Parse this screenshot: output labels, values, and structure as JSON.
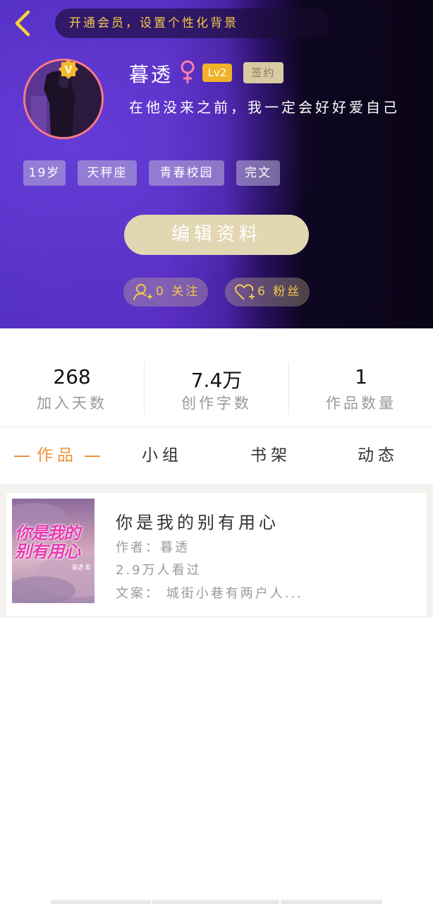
{
  "header": {
    "vip_prompt": "开通会员，设置个性化背景",
    "user_name": "暮透",
    "level": "Lv2",
    "signed": "签约",
    "bio": "在他没来之前，我一定会好好爱自己",
    "tags": [
      "19岁",
      "天秤座",
      "青春校园",
      "完文"
    ],
    "edit_button": "编辑资料",
    "follow": "0 关注",
    "fans": "6 粉丝",
    "colors": {
      "accent_gold": "#f2c84a",
      "header_purple": "#5530c4"
    }
  },
  "stats": [
    {
      "value": "268",
      "label": "加入天数"
    },
    {
      "value": "7.4万",
      "label": "创作字数"
    },
    {
      "value": "1",
      "label": "作品数量"
    }
  ],
  "tabs": [
    {
      "label": "作品",
      "active": true
    },
    {
      "label": "小组",
      "active": false
    },
    {
      "label": "书架",
      "active": false
    },
    {
      "label": "动态",
      "active": false
    }
  ],
  "works": [
    {
      "title": "你是我的别有用心",
      "cover_title": "你是我的别有用心",
      "cover_author": "暮透 著",
      "author": "作者：暮透",
      "views": "2.9万人看过",
      "synopsis": "文案： 城街小巷有两户人..."
    }
  ]
}
